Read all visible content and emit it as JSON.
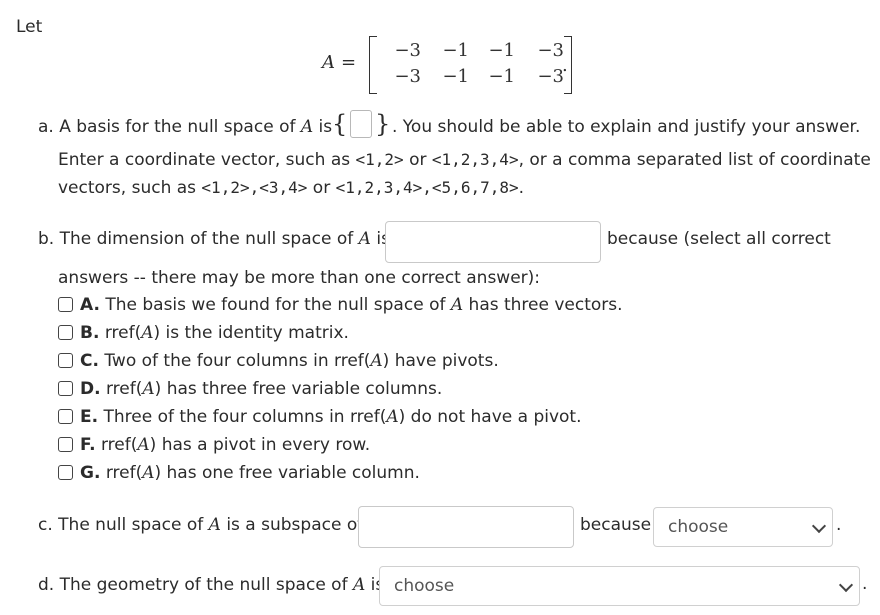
{
  "intro": "Let",
  "matrix": {
    "name": "A",
    "equals": "=",
    "rows": [
      [
        "−3",
        "−1",
        "−1",
        "−3"
      ],
      [
        "−3",
        "−1",
        "−1",
        "−3"
      ]
    ],
    "trailing": "."
  },
  "part_a": {
    "prefix": "a. A basis for the null space of ",
    "var": "A",
    "is": " is ",
    "brace_open": "{",
    "brace_close": "}",
    "after": ". You should be able to explain and justify your answer.",
    "line2_pre": "Enter a coordinate vector, such as ",
    "ex1": "<1,2>",
    "or1": " or ",
    "ex2": "<1,2,3,4>",
    "line2_post": ", or a comma separated list of coordinate",
    "line3_pre": "vectors, such as ",
    "ex3": "<1,2>,<3,4>",
    "or2": " or ",
    "ex4": "<1,2,3,4>,<5,6,7,8>",
    "line3_post": "."
  },
  "part_b": {
    "prefix": "b. The dimension of the null space of ",
    "var": "A",
    "is": " is",
    "because": "because (select all correct",
    "line2": "answers -- there may be more than one correct answer):",
    "options": [
      {
        "letter": "A.",
        "parts": [
          " The basis we found for the null space of ",
          "A",
          " has three vectors."
        ]
      },
      {
        "letter": "B.",
        "parts": [
          " rref(",
          "A",
          ") is the identity matrix."
        ]
      },
      {
        "letter": "C.",
        "parts": [
          " Two of the four columns in rref(",
          "A",
          ") have pivots."
        ]
      },
      {
        "letter": "D.",
        "parts": [
          " rref(",
          "A",
          ") has three free variable columns."
        ]
      },
      {
        "letter": "E.",
        "parts": [
          " Three of the four columns in rref(",
          "A",
          ") do not have a pivot."
        ]
      },
      {
        "letter": "F.",
        "parts": [
          " rref(",
          "A",
          ") has a pivot in every row."
        ]
      },
      {
        "letter": "G.",
        "parts": [
          " rref(",
          "A",
          ") has one free variable column."
        ]
      }
    ]
  },
  "part_c": {
    "prefix": "c. The null space of ",
    "var": "A",
    "is": " is a subspace of",
    "because": "because",
    "select_value": "choose",
    "trailing": "."
  },
  "part_d": {
    "prefix": "d. The geometry of the null space of ",
    "var": "A",
    "is": " is",
    "select_value": "choose",
    "trailing": "."
  }
}
